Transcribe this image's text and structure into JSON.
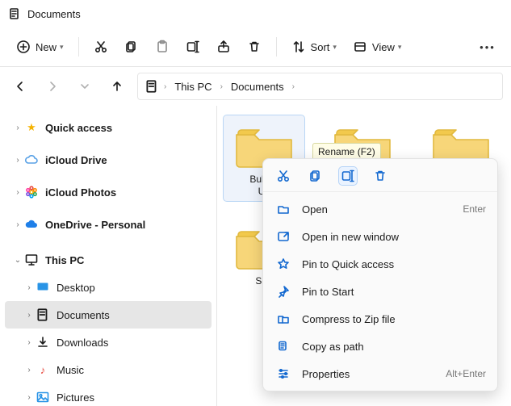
{
  "window": {
    "title": "Documents"
  },
  "toolbar": {
    "new_label": "New",
    "sort_label": "Sort",
    "view_label": "View"
  },
  "breadcrumb": {
    "pc": "This PC",
    "docs": "Documents"
  },
  "sidebar": {
    "quick_access": "Quick access",
    "icloud_drive": "iCloud Drive",
    "icloud_photos": "iCloud Photos",
    "onedrive": "OneDrive - Personal",
    "this_pc": "This PC",
    "desktop": "Desktop",
    "documents": "Documents",
    "downloads": "Downloads",
    "music": "Music",
    "pictures": "Pictures"
  },
  "tiles": {
    "t1": "Bulk R\nUti",
    "t2": "Sha"
  },
  "tooltip": {
    "rename": "Rename (F2)"
  },
  "context": {
    "open": "Open",
    "open_hot": "Enter",
    "open_new": "Open in new window",
    "pin_qa": "Pin to Quick access",
    "pin_start": "Pin to Start",
    "zip": "Compress to Zip file",
    "copy_path": "Copy as path",
    "properties": "Properties",
    "properties_hot": "Alt+Enter"
  }
}
